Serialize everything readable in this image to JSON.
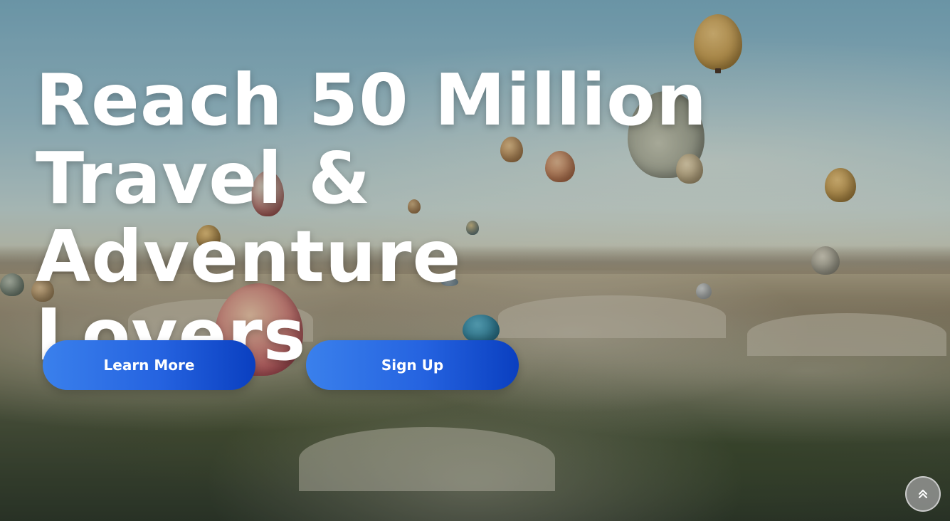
{
  "hero": {
    "headline_lines": [
      "Reach 50 Million",
      "Travel & Adventure",
      "Lovers"
    ],
    "buttons": {
      "learn_more": "Learn More",
      "sign_up": "Sign Up"
    }
  },
  "scroll_top": {
    "icon": "double-chevron-up-icon"
  },
  "colors": {
    "button_gradient_start": "#3a80ec",
    "button_gradient_end": "#0a3fc0",
    "headline": "#ffffff"
  }
}
